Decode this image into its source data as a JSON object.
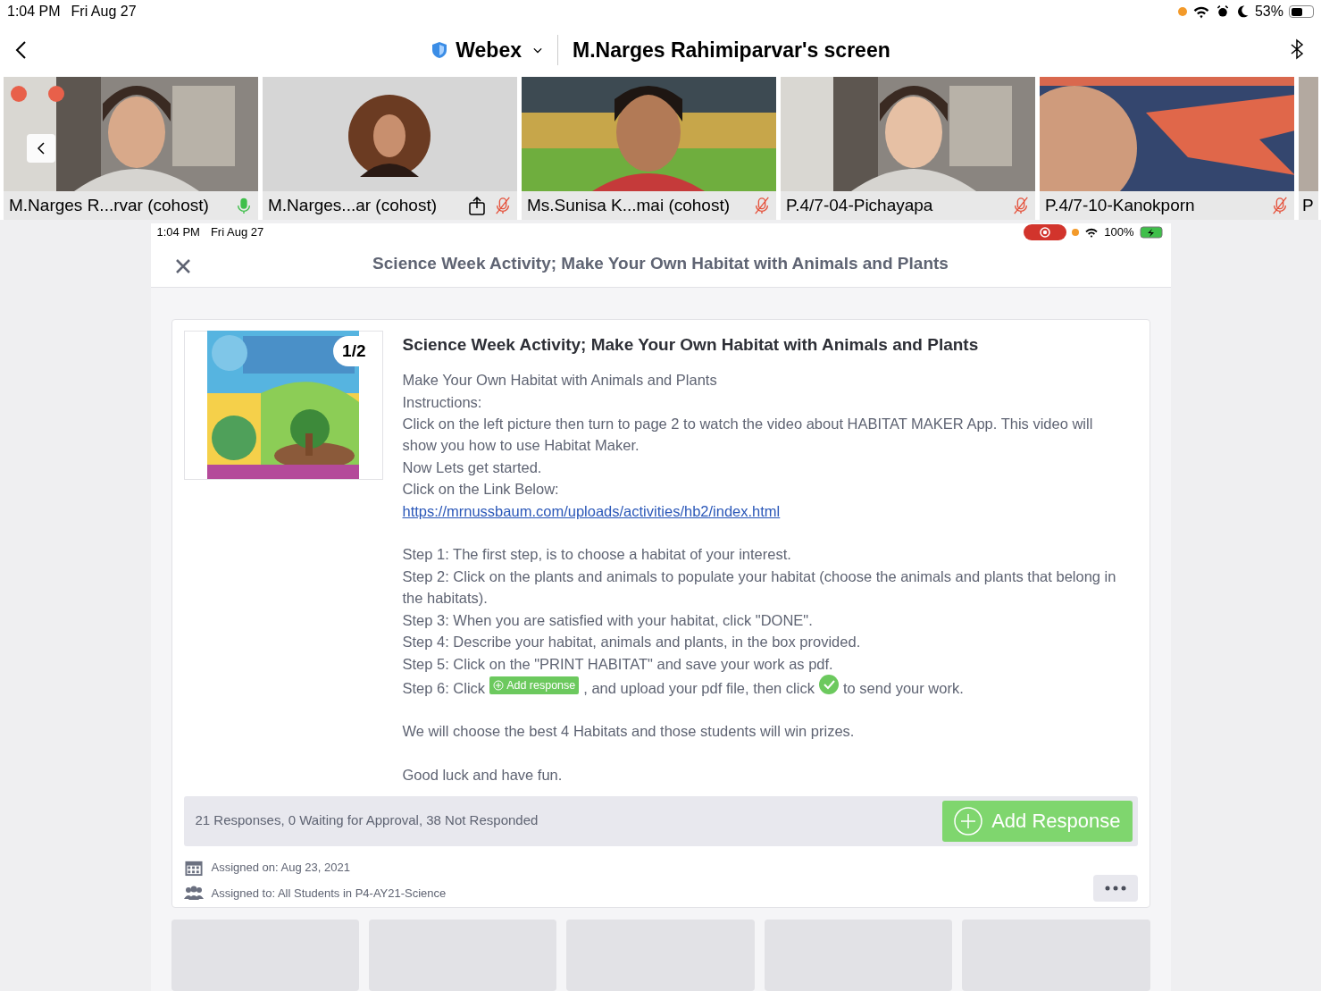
{
  "status_bar": {
    "time": "1:04 PM",
    "date": "Fri Aug 27",
    "battery": "53%",
    "level": 0.53
  },
  "header": {
    "app": "Webex",
    "title": "M.Narges Rahimiparvar's screen"
  },
  "participants": [
    {
      "name": "M.Narges R...rvar (cohost)",
      "muted": false,
      "sharing": false
    },
    {
      "name": "M.Narges...ar (cohost)",
      "muted": true,
      "sharing": true
    },
    {
      "name": "Ms.Sunisa K...mai (cohost)",
      "muted": true,
      "sharing": false
    },
    {
      "name": "P.4/7-04-Pichayapa",
      "muted": true,
      "sharing": false
    },
    {
      "name": "P.4/7-10-Kanokporn",
      "muted": true,
      "sharing": false
    },
    {
      "name": "P"
    }
  ],
  "shared_screen": {
    "status_bar": {
      "time": "1:04 PM",
      "date": "Fri Aug 27",
      "battery": "100%",
      "recording": true
    },
    "title": "Science Week Activity; Make Your Own Habitat with Animals and Plants",
    "card": {
      "page_badge": "1/2",
      "heading": "Science Week Activity; Make Your Own Habitat with Animals and Plants",
      "body": [
        {
          "kind": "text",
          "text": "Make Your Own Habitat with Animals and Plants"
        },
        {
          "kind": "text",
          "text": "Instructions:"
        },
        {
          "kind": "text",
          "text": "Click on the left picture then turn to page 2 to watch the video about HABITAT MAKER App. This video will show you how to use Habitat Maker."
        },
        {
          "kind": "text",
          "text": "Now Lets get started."
        },
        {
          "kind": "text",
          "text": "Click on the Link Below:"
        },
        {
          "kind": "link",
          "text": "https://mrnussbaum.com/uploads/activities/hb2/index.html"
        },
        {
          "kind": "blank"
        },
        {
          "kind": "text",
          "text": "Step 1: The first step, is to choose a habitat of your interest."
        },
        {
          "kind": "text",
          "text": "Step 2: Click on the plants and animals to populate your habitat (choose the animals and plants that belong in the habitats)."
        },
        {
          "kind": "text",
          "text": "Step 3: When you are satisfied with your habitat, click \"DONE\"."
        },
        {
          "kind": "text",
          "text": "Step 4: Describe your habitat, animals and plants, in the box provided."
        },
        {
          "kind": "text",
          "text": "Step 5: Click on the \"PRINT HABITAT\" and save your work as pdf."
        },
        {
          "kind": "inline",
          "before": "Step 6: Click",
          "chip": "Add response",
          "middle": ", and upload your pdf file, then click",
          "after": "to send your work."
        },
        {
          "kind": "blank"
        },
        {
          "kind": "text",
          "text": "We will choose the best 4 Habitats and those students will win prizes."
        },
        {
          "kind": "blank"
        },
        {
          "kind": "text",
          "text": "Good luck and have fun."
        }
      ],
      "summary": "21 Responses, 0 Waiting for Approval, 38 Not Responded",
      "add_button": "Add Response",
      "assigned_on": "Assigned on: Aug 23, 2021",
      "assigned_to": "Assigned to: All Students in P4-AY21-Science"
    }
  }
}
